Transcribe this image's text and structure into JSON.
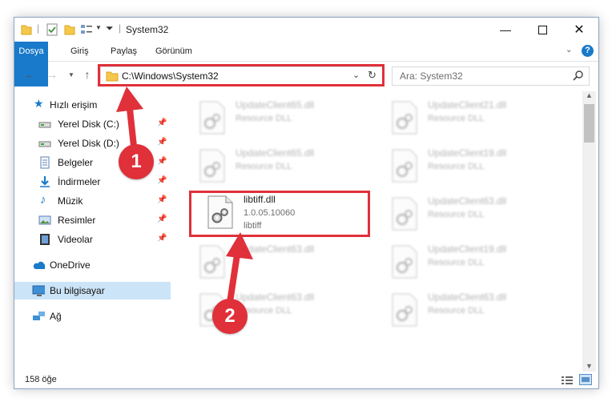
{
  "window": {
    "title": "System32"
  },
  "ribbon": {
    "tabs": [
      "Dosya",
      "Giriş",
      "Paylaş",
      "Görünüm"
    ]
  },
  "address": {
    "path": "C:\\Windows\\System32",
    "search_placeholder": "Ara: System32"
  },
  "nav": {
    "items": [
      {
        "label": "Hızlı erişim",
        "icon": "star-icon",
        "pinned": false
      },
      {
        "label": "Yerel Disk (C:)",
        "icon": "drive-icon",
        "pinned": true
      },
      {
        "label": "Yerel Disk (D:)",
        "icon": "drive-icon",
        "pinned": true
      },
      {
        "label": "Belgeler",
        "icon": "documents-icon",
        "pinned": true
      },
      {
        "label": "İndirmeler",
        "icon": "download-icon",
        "pinned": true
      },
      {
        "label": "Müzik",
        "icon": "music-icon",
        "pinned": true
      },
      {
        "label": "Resimler",
        "icon": "pictures-icon",
        "pinned": true
      },
      {
        "label": "Videolar",
        "icon": "video-icon",
        "pinned": true
      },
      {
        "label": "OneDrive",
        "icon": "cloud-icon",
        "pinned": false
      },
      {
        "label": "Bu bilgisayar",
        "icon": "computer-icon",
        "pinned": false
      },
      {
        "label": "Ağ",
        "icon": "network-icon",
        "pinned": false
      }
    ]
  },
  "files": [
    {
      "name": "UpdateClient65.dll",
      "line1": "Resource DLL",
      "line2": ""
    },
    {
      "name": "UpdateClient21.dll",
      "line1": "Resource DLL",
      "line2": ""
    },
    {
      "name": "UpdateClient65.dll",
      "line1": "Resource DLL",
      "line2": ""
    },
    {
      "name": "UpdateClient19.dll",
      "line1": "Resource DLL",
      "line2": ""
    },
    {
      "name": "libtiff.dll",
      "line1": "1.0.05.10060",
      "line2": "libtiff"
    },
    {
      "name": "UpdateClient63.dll",
      "line1": "Resource DLL",
      "line2": ""
    },
    {
      "name": "UpdateClient63.dll",
      "line1": "",
      "line2": ""
    },
    {
      "name": "UpdateClient19.dll",
      "line1": "Resource DLL",
      "line2": ""
    },
    {
      "name": "UpdateClient63.dll",
      "line1": "Resource DLL",
      "line2": ""
    },
    {
      "name": "UpdateClient63.dll",
      "line1": "Resource DLL",
      "line2": ""
    }
  ],
  "status": {
    "count": "158 öğe"
  },
  "callouts": [
    "1",
    "2"
  ],
  "colors": {
    "accent": "#1979ca",
    "highlight": "#e0303a",
    "selection": "#cce4f7"
  }
}
